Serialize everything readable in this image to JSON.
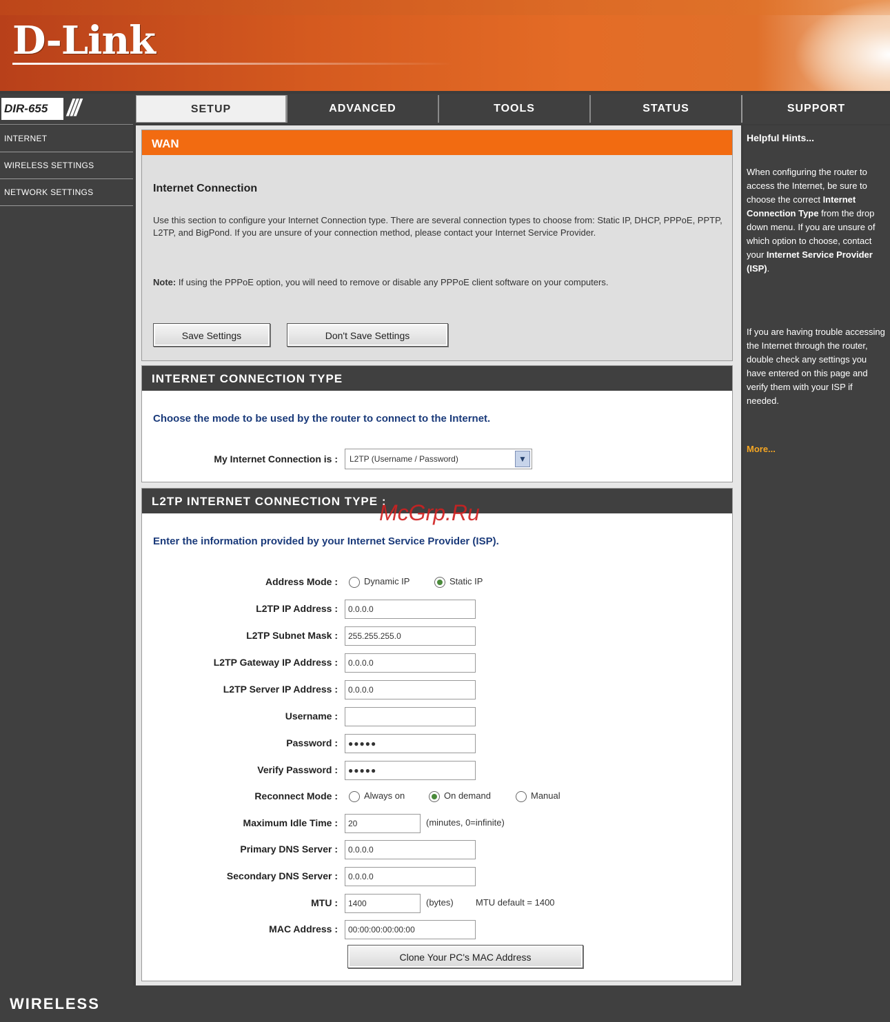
{
  "brand": {
    "logo": "D-Link",
    "model": "DIR-655"
  },
  "tabs": [
    {
      "label": "SETUP",
      "active": true
    },
    {
      "label": "ADVANCED",
      "active": false
    },
    {
      "label": "TOOLS",
      "active": false
    },
    {
      "label": "STATUS",
      "active": false
    },
    {
      "label": "SUPPORT",
      "active": false
    }
  ],
  "sidebar": {
    "items": [
      {
        "label": "INTERNET"
      },
      {
        "label": "WIRELESS SETTINGS"
      },
      {
        "label": "NETWORK SETTINGS"
      }
    ]
  },
  "wan": {
    "header": "WAN",
    "subheading": "Internet Connection",
    "description": "Use this section to configure your Internet Connection type. There are several connection types to choose from: Static IP, DHCP, PPPoE, PPTP, L2TP, and BigPond. If you are unsure of your connection method, please contact your Internet Service Provider.",
    "note_label": "Note:",
    "note_text": " If using the PPPoE option, you will need to remove or disable any PPPoE client software on your computers.",
    "save_label": "Save Settings",
    "dont_save_label": "Don't Save Settings"
  },
  "ict": {
    "header": "INTERNET CONNECTION TYPE",
    "intro": "Choose the mode to be used by the router to connect to the Internet.",
    "label": "My Internet Connection is :",
    "selected": "L2TP (Username / Password)"
  },
  "l2tp": {
    "header": "L2TP INTERNET CONNECTION TYPE :",
    "intro": "Enter the information provided by your Internet Service Provider (ISP).",
    "address_mode": {
      "label": "Address Mode :",
      "opt1": "Dynamic IP",
      "opt2": "Static IP",
      "selected": "Static IP"
    },
    "ip": {
      "label": "L2TP IP Address :",
      "value": "0.0.0.0"
    },
    "mask": {
      "label": "L2TP Subnet Mask :",
      "value": "255.255.255.0"
    },
    "gateway": {
      "label": "L2TP Gateway IP Address :",
      "value": "0.0.0.0"
    },
    "server": {
      "label": "L2TP Server IP Address :",
      "value": "0.0.0.0"
    },
    "username": {
      "label": "Username :",
      "value": ""
    },
    "password": {
      "label": "Password :",
      "value": "●●●●●"
    },
    "verify": {
      "label": "Verify Password :",
      "value": "●●●●●"
    },
    "reconnect": {
      "label": "Reconnect Mode :",
      "opt1": "Always on",
      "opt2": "On demand",
      "opt3": "Manual",
      "selected": "On demand"
    },
    "idle": {
      "label": "Maximum Idle Time :",
      "value": "20",
      "unit": "(minutes, 0=infinite)"
    },
    "dns1": {
      "label": "Primary DNS Server :",
      "value": "0.0.0.0"
    },
    "dns2": {
      "label": "Secondary DNS Server :",
      "value": "0.0.0.0"
    },
    "mtu": {
      "label": "MTU :",
      "value": "1400",
      "unit": "(bytes)",
      "default": "MTU default = 1400"
    },
    "mac": {
      "label": "MAC Address :",
      "value": "00:00:00:00:00:00"
    },
    "clone_label": "Clone Your PC's MAC Address"
  },
  "hints": {
    "title": "Helpful Hints...",
    "p1_a": "When configuring the router to access the Internet, be sure to choose the correct ",
    "p1_b": "Internet Connection Type",
    "p1_c": " from the drop down menu. If you are unsure of which option to choose, contact your ",
    "p1_d": "Internet Service Provider (ISP)",
    "p1_e": ".",
    "p2": "If you are having trouble accessing the Internet through the router, double check any settings you have entered on this page and verify them with your ISP if needed.",
    "more": "More..."
  },
  "footer": {
    "label": "WIRELESS"
  },
  "watermark": "McGrp.Ru"
}
